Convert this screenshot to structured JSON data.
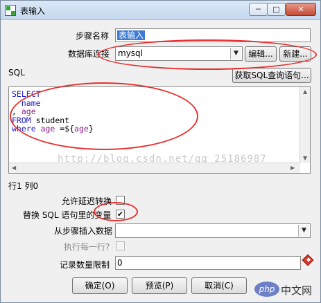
{
  "window": {
    "title": "表输入",
    "minimize": "─",
    "maximize": "□",
    "close": "✕"
  },
  "fields": {
    "step_name_label": "步骤名称",
    "step_name_value": "表输入",
    "db_connection_label": "数据库连接",
    "db_connection_value": "mysql",
    "edit_button": "编辑...",
    "new_button": "新建...",
    "sql_label": "SQL",
    "get_sql_button": "获取SQL查询语句..."
  },
  "sql_lines": [
    [
      {
        "t": "SELECT",
        "c": "kw"
      }
    ],
    [
      {
        "t": "  name",
        "c": "kw"
      }
    ],
    [
      {
        "t": ", ",
        "c": "fn"
      },
      {
        "t": "age",
        "c": "col"
      }
    ],
    [
      {
        "t": "FROM",
        "c": "kw"
      },
      {
        "t": " student",
        "c": "fn"
      }
    ],
    [
      {
        "t": "where",
        "c": "kw"
      },
      {
        "t": " ",
        "c": "fn"
      },
      {
        "t": "age",
        "c": "col"
      },
      {
        "t": " =${",
        "c": "fn"
      },
      {
        "t": "age",
        "c": "col"
      },
      {
        "t": "}",
        "c": "fn"
      }
    ]
  ],
  "watermark": "http://blog.csdn.net/qq_25186987",
  "cursor_position": "行1 列0",
  "options": {
    "lazy_conversion_label": "允许延迟转换",
    "lazy_conversion_checked": false,
    "replace_vars_label": "替换 SQL 语句里的变量",
    "replace_vars_checked": true,
    "insert_from_step_label": "从步骤插入数据",
    "insert_from_step_value": "",
    "execute_each_row_label": "执行每一行?",
    "execute_each_row_checked": false,
    "record_limit_label": "记录数量限制",
    "record_limit_value": "0"
  },
  "buttons": {
    "ok": "确定(O)",
    "preview": "预览(P)",
    "cancel": "取消(C)"
  },
  "brand": {
    "badge": "php",
    "text": "中文网"
  },
  "colors": {
    "annotation_red": "#e8302e",
    "sql_keyword": "#1b1bd6",
    "sql_column": "#8b1a8b",
    "selection": "#3b7bd6"
  }
}
